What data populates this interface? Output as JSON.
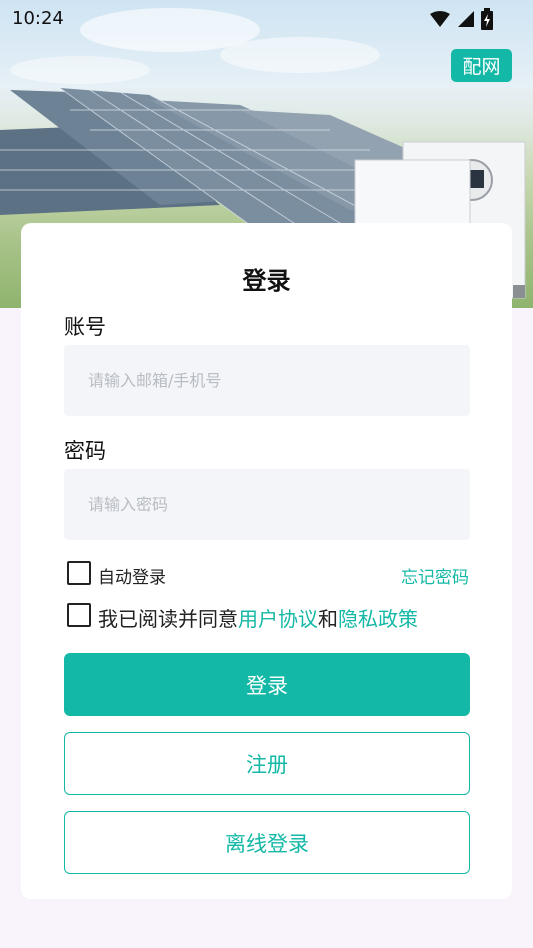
{
  "status_bar": {
    "time": "10:24"
  },
  "header": {
    "pair_network_label": "配网"
  },
  "login": {
    "title": "登录",
    "account_label": "账号",
    "account_placeholder": "请输入邮箱/手机号",
    "password_label": "密码",
    "password_placeholder": "请输入密码",
    "auto_login_label": "自动登录",
    "forgot_password_label": "忘记密码",
    "agreement_prefix": "我已阅读并同意",
    "user_agreement_link": "用户协议",
    "agreement_and": "和",
    "privacy_policy_link": "隐私政策",
    "login_button": "登录",
    "register_button": "注册",
    "offline_login_button": "离线登录"
  },
  "colors": {
    "accent": "#14b8a6",
    "background": "#f9f4fc"
  }
}
